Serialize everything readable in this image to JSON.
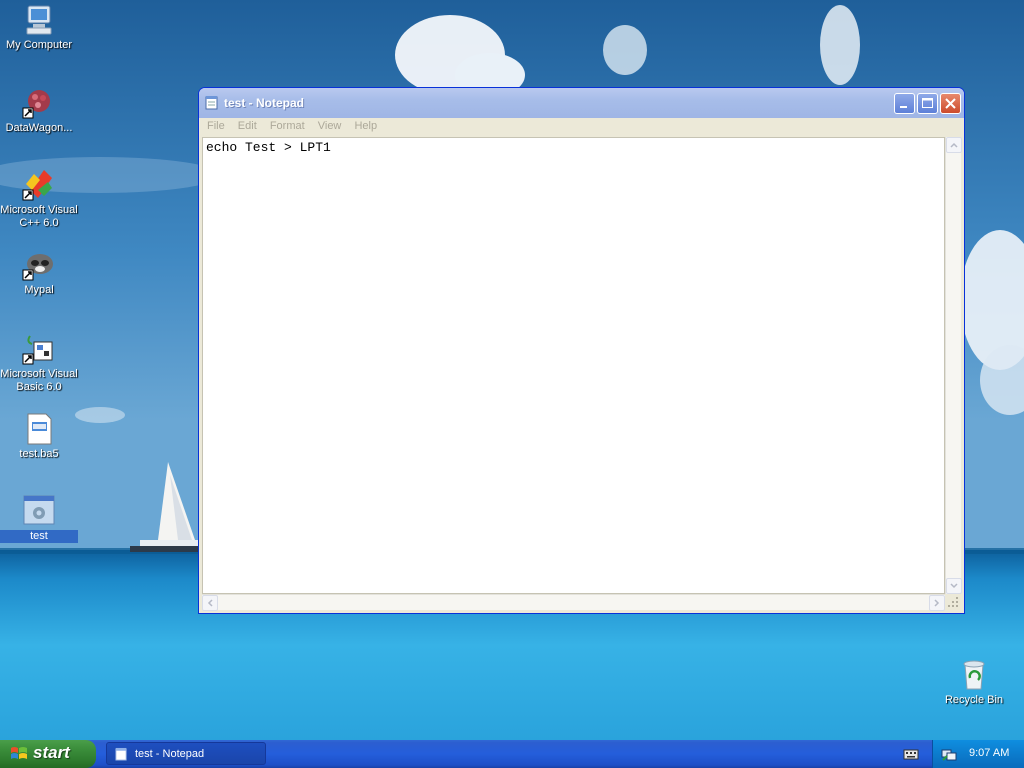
{
  "desktop": {
    "icons": [
      {
        "label": "My Computer",
        "icon": "my-computer-icon"
      },
      {
        "label": "DataWagon...",
        "icon": "datawagon-icon"
      },
      {
        "label": "Microsoft Visual C++ 6.0",
        "icon": "visual-cpp-icon"
      },
      {
        "label": "Mypal",
        "icon": "mypal-icon"
      },
      {
        "label": "Microsoft Visual Basic 6.0",
        "icon": "visual-basic-icon"
      },
      {
        "label": "test.ba5",
        "icon": "document-icon"
      },
      {
        "label": "test",
        "icon": "batch-file-icon"
      },
      {
        "label": "Recycle Bin",
        "icon": "recycle-bin-icon"
      }
    ]
  },
  "window": {
    "title": "test - Notepad",
    "menu": [
      "File",
      "Edit",
      "Format",
      "View",
      "Help"
    ],
    "content": "echo Test > LPT1"
  },
  "taskbar": {
    "start_label": "start",
    "task_label": "test - Notepad",
    "clock": "9:07 AM"
  },
  "colors": {
    "taskbar": "#245edb",
    "start_button": "#3c8f3c",
    "title_bar_inactive": "#a7bde9",
    "tray": "#0c7ccd"
  }
}
